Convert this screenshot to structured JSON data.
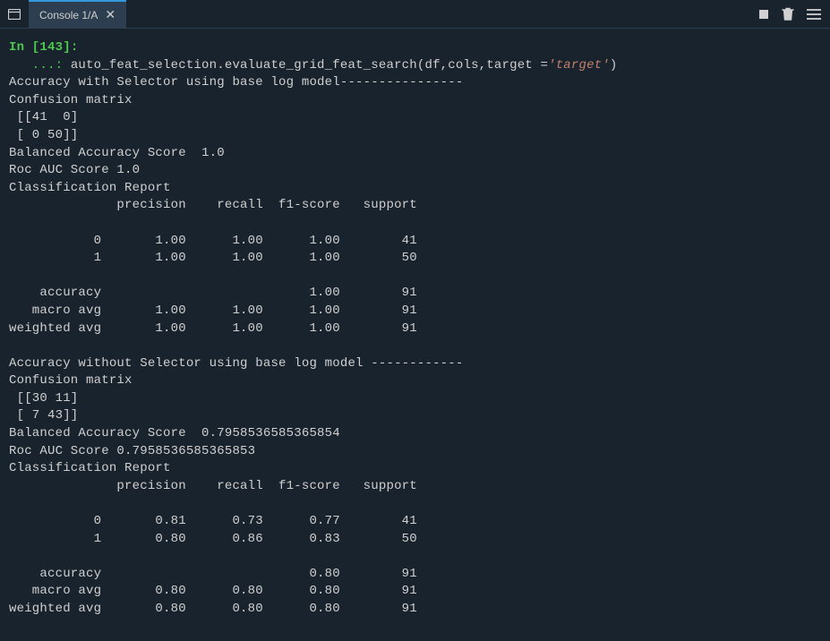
{
  "tab": {
    "label": "Console 1/A"
  },
  "prompt": {
    "in_label": "In [",
    "num": "143",
    "in_close": "]:",
    "cont": "   ...: ",
    "code_prefix": "auto_feat_selection.evaluate_grid_feat_search(df,cols,target =",
    "string_literal": "'target'",
    "code_suffix": ")"
  },
  "output": {
    "section1": {
      "header": "Accuracy with Selector using base log model----------------",
      "cm_label": "Confusion matrix",
      "cm_row1": " [[41  0]",
      "cm_row2": " [ 0 50]]",
      "balanced": "Balanced Accuracy Score  1.0",
      "roc": "Roc AUC Score 1.0",
      "report_label": "Classification Report",
      "report_header": "              precision    recall  f1-score   support",
      "report_blank1": "",
      "report_class0": "           0       1.00      1.00      1.00        41",
      "report_class1": "           1       1.00      1.00      1.00        50",
      "report_blank2": "",
      "report_acc": "    accuracy                           1.00        91",
      "report_macro": "   macro avg       1.00      1.00      1.00        91",
      "report_weighted": "weighted avg       1.00      1.00      1.00        91"
    },
    "section2": {
      "header": "Accuracy without Selector using base log model ------------",
      "cm_label": "Confusion matrix",
      "cm_row1": " [[30 11]",
      "cm_row2": " [ 7 43]]",
      "balanced": "Balanced Accuracy Score  0.7958536585365854",
      "roc": "Roc AUC Score 0.7958536585365853",
      "report_label": "Classification Report",
      "report_header": "              precision    recall  f1-score   support",
      "report_blank1": "",
      "report_class0": "           0       0.81      0.73      0.77        41",
      "report_class1": "           1       0.80      0.86      0.83        50",
      "report_blank2": "",
      "report_acc": "    accuracy                           0.80        91",
      "report_macro": "   macro avg       0.80      0.80      0.80        91",
      "report_weighted": "weighted avg       0.80      0.80      0.80        91"
    }
  }
}
